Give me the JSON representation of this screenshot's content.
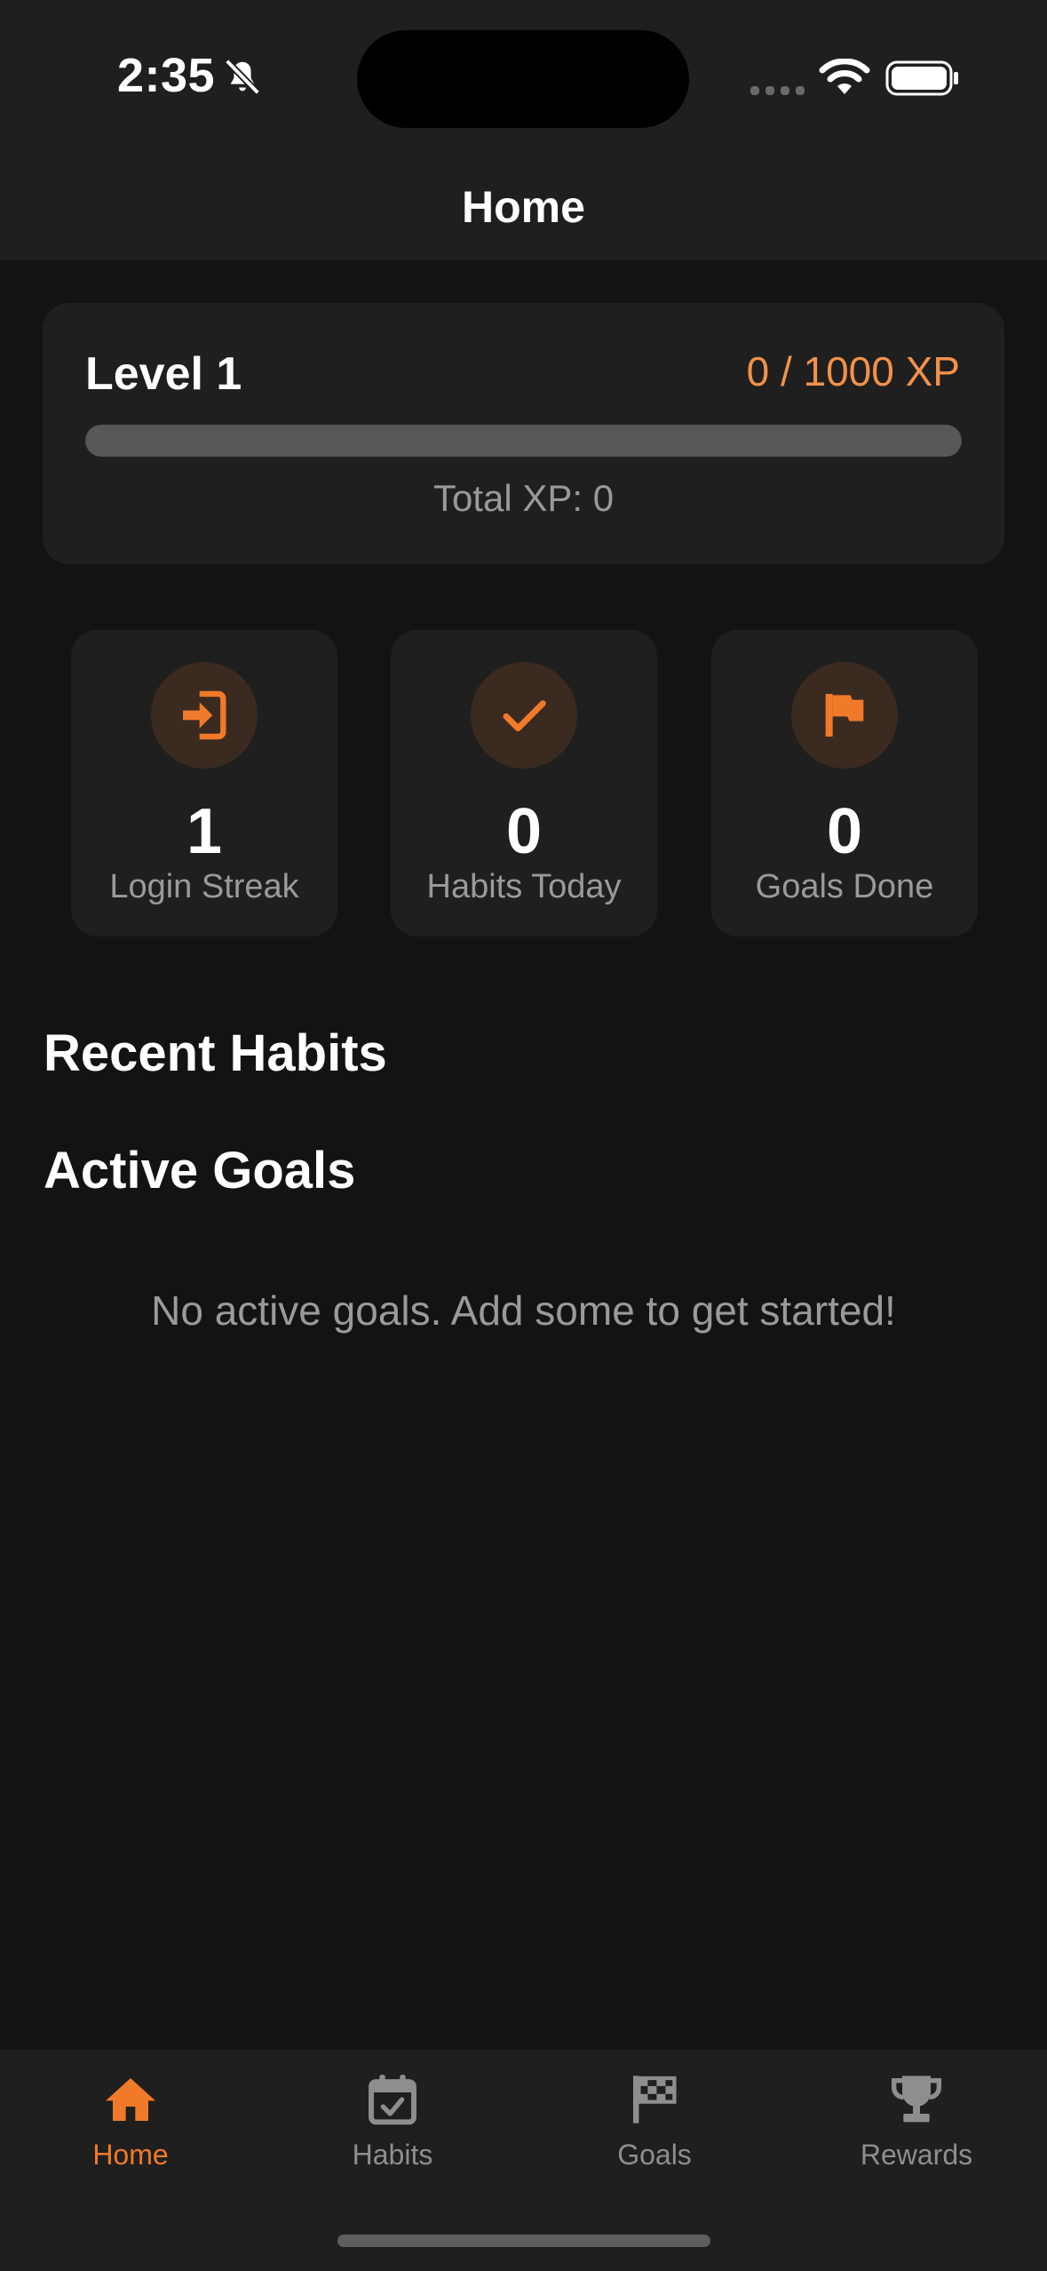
{
  "status_bar": {
    "time": "2:35",
    "icons": [
      "bell-slash-icon",
      "signal-icon",
      "wifi-icon",
      "battery-icon"
    ]
  },
  "header": {
    "title": "Home"
  },
  "level_card": {
    "level_label": "Level 1",
    "xp_text": "0 / 1000 XP",
    "progress_fraction": 0,
    "total_xp_text": "Total XP: 0"
  },
  "stats": [
    {
      "icon": "login-icon",
      "value": "1",
      "label": "Login Streak"
    },
    {
      "icon": "checkmark-icon",
      "value": "0",
      "label": "Habits Today"
    },
    {
      "icon": "flag-icon",
      "value": "0",
      "label": "Goals Done"
    }
  ],
  "sections": {
    "recent_habits_title": "Recent Habits",
    "active_goals_title": "Active Goals",
    "active_goals_empty": "No active goals. Add some to get started!"
  },
  "tabbar": {
    "tabs": [
      {
        "label": "Home",
        "icon": "home-icon",
        "active": true
      },
      {
        "label": "Habits",
        "icon": "calendar-check-icon",
        "active": false
      },
      {
        "label": "Goals",
        "icon": "checkered-flag-icon",
        "active": false
      },
      {
        "label": "Rewards",
        "icon": "trophy-icon",
        "active": false
      }
    ]
  },
  "colors": {
    "accent": "#f07a2a",
    "background": "#131313",
    "card": "#1f1f1f",
    "muted_text": "#9a9a9a",
    "icon_circle": "#3b2a20"
  }
}
